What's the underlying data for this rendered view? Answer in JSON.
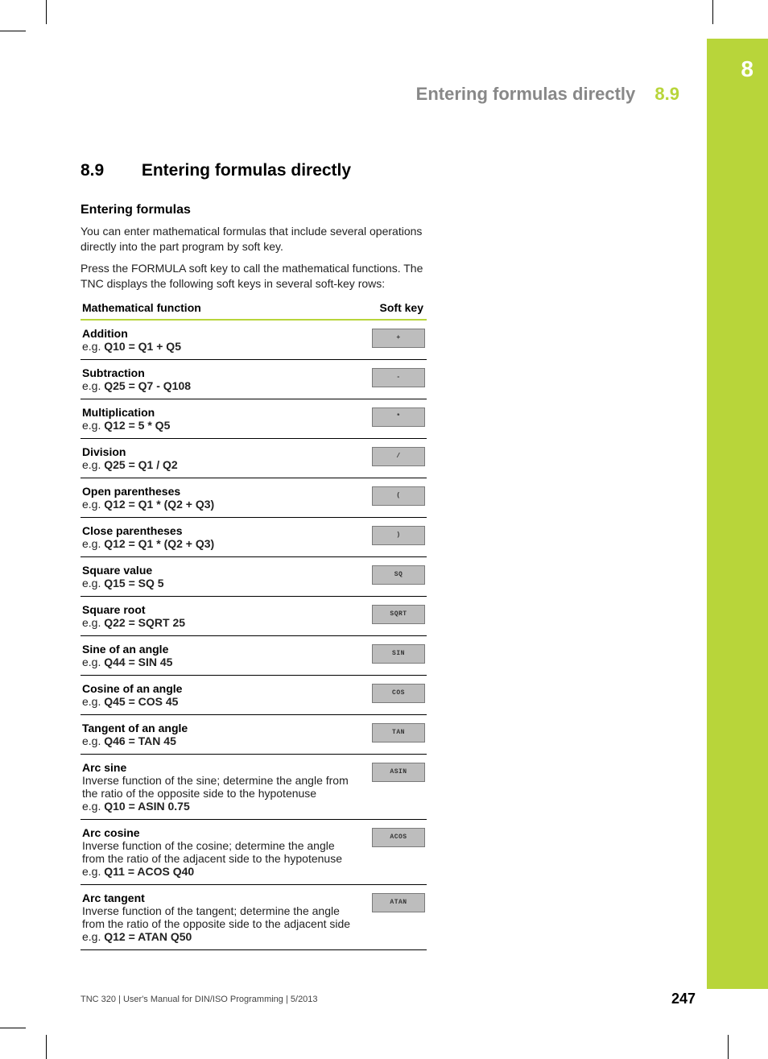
{
  "chapter_tab": "8",
  "header": {
    "title": "Entering formulas directly",
    "section": "8.9"
  },
  "section": {
    "number": "8.9",
    "title": "Entering formulas directly"
  },
  "subsection_title": "Entering formulas",
  "para1": "You can enter mathematical formulas that include several operations directly into the part program by soft key.",
  "para2": "Press the FORMULA soft key to call the mathematical functions. The TNC displays the following soft keys in several soft-key rows:",
  "table": {
    "col1": "Mathematical function",
    "col2": "Soft key",
    "rows": [
      {
        "name": "Addition",
        "desc": "",
        "example": "Q10 = Q1 + Q5",
        "key": "+"
      },
      {
        "name": "Subtraction",
        "desc": "",
        "example": "Q25 = Q7 - Q108",
        "key": "-"
      },
      {
        "name": "Multiplication",
        "desc": "",
        "example": "Q12 = 5 * Q5",
        "key": "*"
      },
      {
        "name": "Division",
        "desc": "",
        "example": "Q25 = Q1 / Q2",
        "key": "/"
      },
      {
        "name": "Open parentheses",
        "desc": "",
        "example": "Q12 = Q1 * (Q2 + Q3)",
        "key": "("
      },
      {
        "name": "Close parentheses",
        "desc": "",
        "example": "Q12 = Q1 * (Q2 + Q3)",
        "key": ")"
      },
      {
        "name": "Square value",
        "desc": "",
        "example": "Q15 = SQ 5",
        "key": "SQ"
      },
      {
        "name": "Square root",
        "desc": "",
        "example": "Q22 = SQRT 25",
        "key": "SQRT"
      },
      {
        "name": "Sine of an angle",
        "desc": "",
        "example": "Q44 = SIN 45",
        "key": "SIN"
      },
      {
        "name": "Cosine of an angle",
        "desc": "",
        "example": "Q45 = COS 45",
        "key": "COS"
      },
      {
        "name": "Tangent of an angle",
        "desc": "",
        "example": "Q46 = TAN 45",
        "key": "TAN"
      },
      {
        "name": "Arc sine",
        "desc": "Inverse function of the sine; determine the angle from the ratio of the opposite side to the hypotenuse",
        "example": "Q10 = ASIN 0.75",
        "key": "ASIN"
      },
      {
        "name": "Arc cosine",
        "desc": "Inverse function of the cosine; determine the angle\nfrom the ratio of the adjacent side to the hypotenuse",
        "example": "Q11 = ACOS Q40",
        "key": "ACOS"
      },
      {
        "name": "Arc tangent",
        "desc": "Inverse function of the tangent; determine the angle\nfrom the ratio of the opposite side to the adjacent side",
        "example": "Q12 = ATAN Q50",
        "key": "ATAN"
      }
    ]
  },
  "footer": {
    "text": "TNC 320 | User's Manual for DIN/ISO Programming | 5/2013",
    "page": "247"
  },
  "labels": {
    "eg_prefix": "e.g. "
  }
}
